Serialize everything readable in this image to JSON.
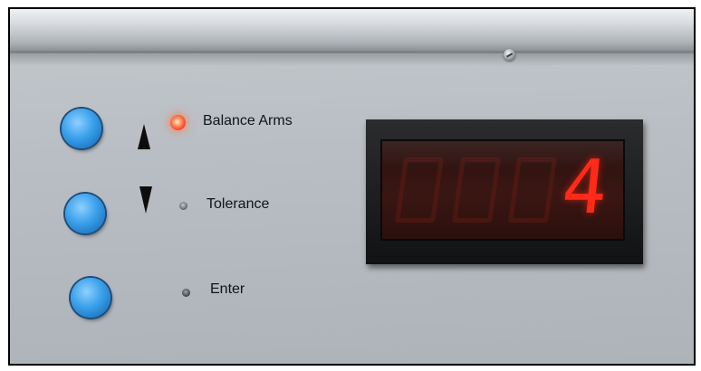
{
  "panel": {
    "buttons": [
      {
        "id": "up",
        "arrow": "up-arrow-icon"
      },
      {
        "id": "down",
        "arrow": "down-arrow-icon"
      },
      {
        "id": "enter",
        "arrow": ""
      }
    ],
    "indicators": [
      {
        "label": "Balance Arms",
        "state": "on",
        "color": "#ff4a2a"
      },
      {
        "label": "Tolerance",
        "state": "off",
        "color": "#6a6f74"
      },
      {
        "label": "Enter",
        "state": "off",
        "color": "#4a4e52"
      }
    ]
  },
  "display": {
    "value": "4",
    "digit_color": "#ff2a18"
  },
  "colors": {
    "button_blue": "#3aa0ea",
    "panel_gray": "#b9bec4",
    "display_bezel": "#111213"
  }
}
